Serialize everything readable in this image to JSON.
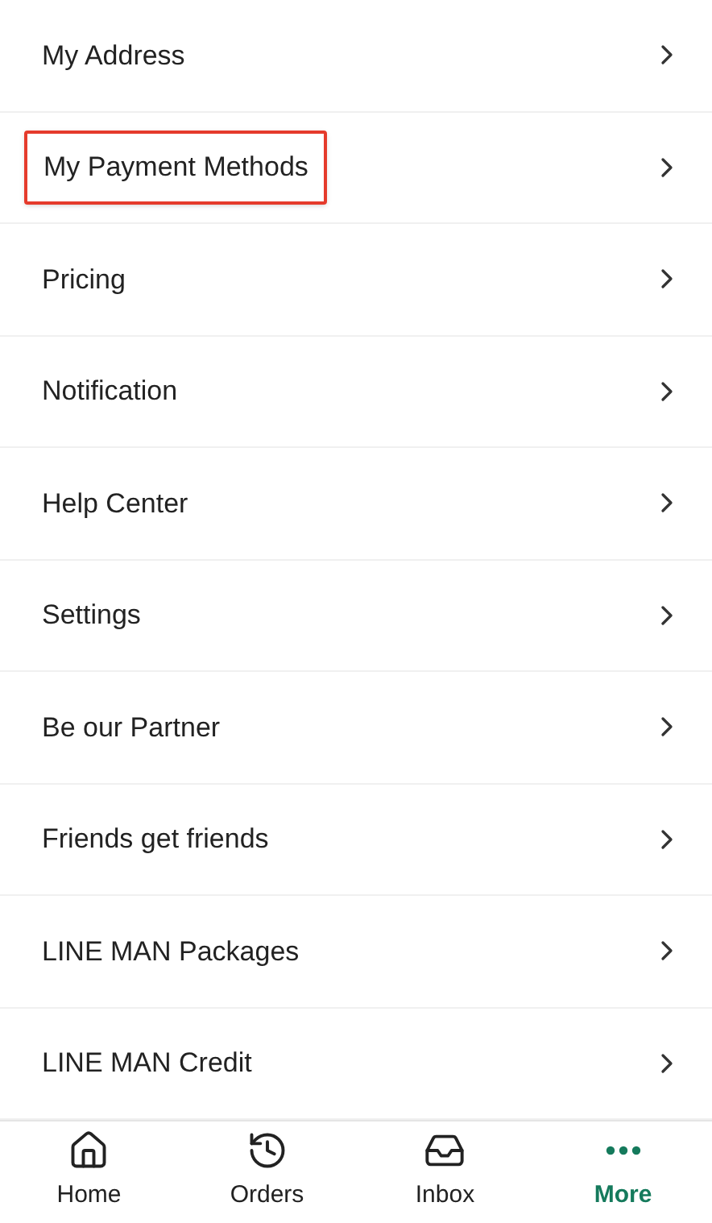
{
  "menu_items": [
    {
      "label": "My Address",
      "highlighted": false
    },
    {
      "label": "My Payment Methods",
      "highlighted": true
    },
    {
      "label": "Pricing",
      "highlighted": false
    },
    {
      "label": "Notification",
      "highlighted": false
    },
    {
      "label": "Help Center",
      "highlighted": false
    },
    {
      "label": "Settings",
      "highlighted": false
    },
    {
      "label": "Be our Partner",
      "highlighted": false
    },
    {
      "label": "Friends get friends",
      "highlighted": false
    },
    {
      "label": "LINE MAN Packages",
      "highlighted": false
    },
    {
      "label": "LINE MAN Credit",
      "highlighted": false
    }
  ],
  "bottom_nav": [
    {
      "kind": "home",
      "label": "Home",
      "selected": false
    },
    {
      "kind": "orders",
      "label": "Orders",
      "selected": false
    },
    {
      "kind": "inbox",
      "label": "Inbox",
      "selected": false
    },
    {
      "kind": "more",
      "label": "More",
      "selected": true
    }
  ]
}
